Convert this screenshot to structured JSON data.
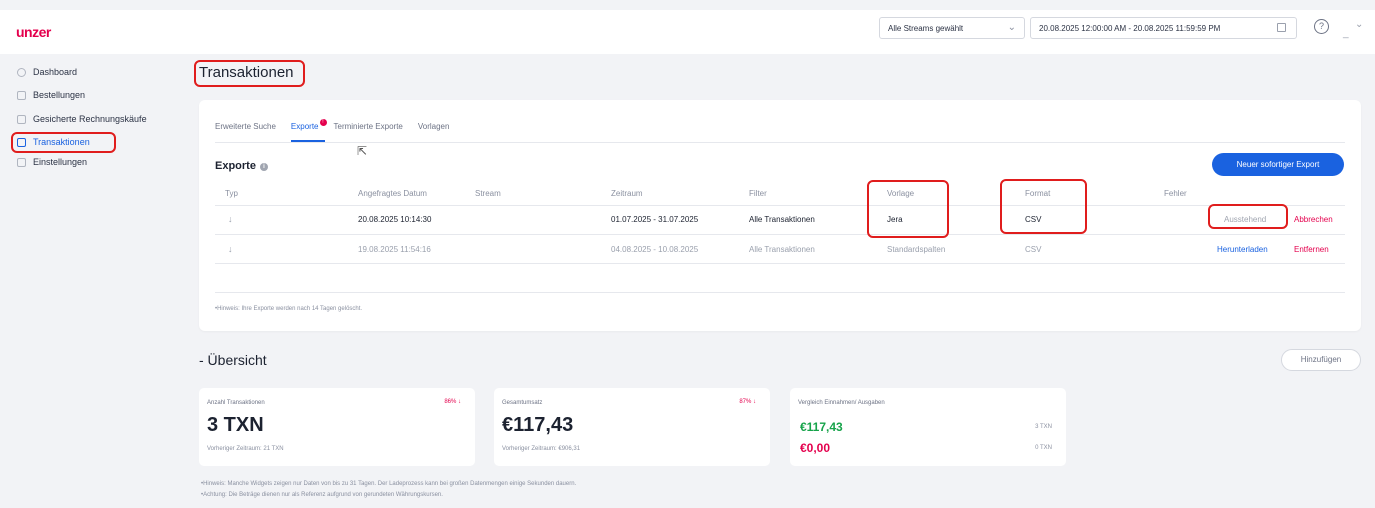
{
  "header": {
    "logo": "unzer",
    "stream_select": "Alle Streams gewählt",
    "date_range": "20.08.2025 12:00:00 AM - 20.08.2025 11:59:59 PM",
    "help": "?"
  },
  "sidebar": {
    "items": [
      {
        "label": "Dashboard",
        "icon": "dashboard-icon"
      },
      {
        "label": "Bestellungen",
        "icon": "orders-icon"
      },
      {
        "label": "Gesicherte Rechnungskäufe",
        "icon": "invoice-icon"
      },
      {
        "label": "Transaktionen",
        "icon": "transactions-icon",
        "active": true
      },
      {
        "label": "Einstellungen",
        "icon": "settings-icon"
      }
    ]
  },
  "page": {
    "title": "Transaktionen"
  },
  "tabs": [
    "Erweiterte Suche",
    "Exporte",
    "Terminierte Exporte",
    "Vorlagen"
  ],
  "tabs_badge": "!",
  "exports": {
    "title": "Exporte",
    "new_button": "Neuer sofortiger Export",
    "columns": [
      "Typ",
      "Angefragtes Datum",
      "Stream",
      "Zeitraum",
      "Filter",
      "Vorlage",
      "Format",
      "Fehler"
    ],
    "rows": [
      {
        "date": "20.08.2025 10:14:30",
        "period": "01.07.2025 - 31.07.2025",
        "filter": "Alle Transaktionen",
        "template": "Jera",
        "format": "CSV",
        "status": "Ausstehend",
        "action": "Abbrechen"
      },
      {
        "date": "19.08.2025 11:54:16",
        "period": "04.08.2025 - 10.08.2025",
        "filter": "Alle Transaktionen",
        "template": "Standardspalten",
        "format": "CSV",
        "download": "Herunterladen",
        "action": "Entfernen"
      }
    ],
    "hint": "•Hinweis: Ihre Exporte werden nach 14 Tagen gelöscht."
  },
  "overview": {
    "title": "- Übersicht",
    "add_button": "Hinzufügen",
    "widgets": [
      {
        "label": "Anzahl Transaktionen",
        "trend": "86% ↓",
        "value": "3 TXN",
        "previous": "Vorheriger Zeitraum: 21 TXN"
      },
      {
        "label": "Gesamtumsatz",
        "trend": "87% ↓",
        "value": "€117,43",
        "previous": "Vorheriger Zeitraum: €906,31"
      },
      {
        "label": "Vergleich Einnahmen/ Ausgaben",
        "income": "€117,43",
        "income_count": "3 TXN",
        "expense": "€0,00",
        "expense_count": "0 TXN"
      }
    ],
    "hint1": "•Hinweis: Manche Widgets zeigen nur Daten von bis zu 31 Tagen. Der Ladeprozess kann bei großen Datenmengen einige Sekunden dauern.",
    "hint2": "•Achtung: Die Beträge dienen nur als Referenz aufgrund von gerundeten Währungskursen."
  },
  "colors": {
    "brand": "#e4004d",
    "accent": "#1a62e0",
    "highlight": "#e01d1d",
    "positive": "#16a34a"
  }
}
